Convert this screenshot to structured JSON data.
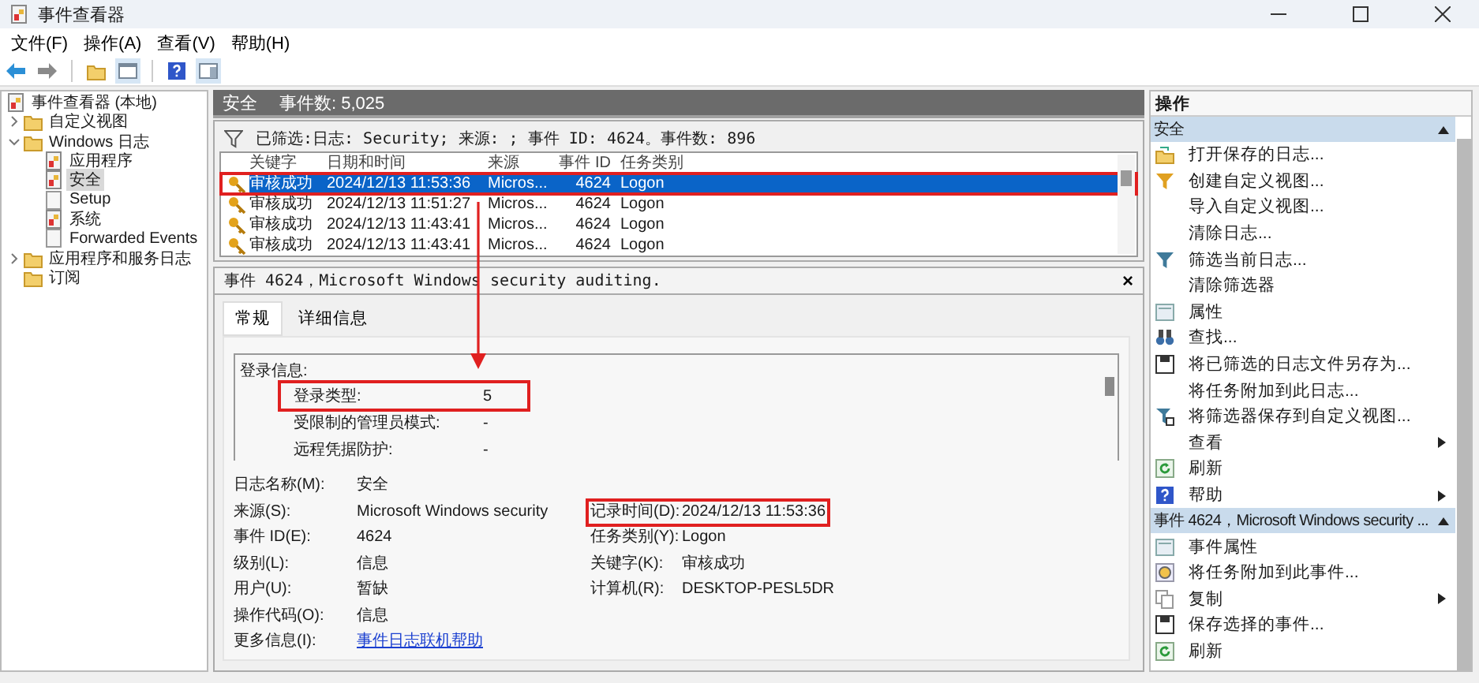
{
  "window": {
    "title": "事件查看器"
  },
  "menu": [
    "文件(F)",
    "操作(A)",
    "查看(V)",
    "帮助(H)"
  ],
  "tree": [
    {
      "label": "事件查看器 (本地)",
      "selected": false,
      "children": [
        {
          "label": "自定义视图",
          "expanded": false,
          "selected": false
        },
        {
          "label": "Windows 日志",
          "expanded": true,
          "selected": false,
          "children": [
            {
              "label": "应用程序",
              "selected": false
            },
            {
              "label": "安全",
              "selected": true
            },
            {
              "label": "Setup",
              "selected": false
            },
            {
              "label": "系统",
              "selected": false
            },
            {
              "label": "Forwarded Events",
              "selected": false
            }
          ]
        },
        {
          "label": "应用程序和服务日志",
          "expanded": false,
          "selected": false
        },
        {
          "label": "订阅",
          "selected": false
        }
      ]
    }
  ],
  "log_header": {
    "title": "安全",
    "count": "事件数: 5,025"
  },
  "filter": "已筛选:日志: Security; 来源: ; 事件 ID: 4624。事件数: 896",
  "events": {
    "columns": [
      "关键字",
      "日期和时间",
      "来源",
      "事件 ID",
      "任务类别"
    ],
    "rows": [
      {
        "cells": [
          "审核成功",
          "2024/12/13 11:53:36",
          "Micros...",
          "4624",
          "Logon"
        ],
        "selected": true,
        "highlighted": true
      },
      {
        "cells": [
          "审核成功",
          "2024/12/13 11:51:27",
          "Micros...",
          "4624",
          "Logon"
        ],
        "selected": false,
        "highlighted": false
      },
      {
        "cells": [
          "审核成功",
          "2024/12/13 11:43:41",
          "Micros...",
          "4624",
          "Logon"
        ],
        "selected": false,
        "highlighted": false
      },
      {
        "cells": [
          "审核成功",
          "2024/12/13 11:43:41",
          "Micros...",
          "4624",
          "Logon"
        ],
        "selected": false,
        "highlighted": false
      }
    ]
  },
  "detail": {
    "title": "事件 4624，Microsoft Windows security auditing.",
    "close": "×",
    "tabs": [
      {
        "label": "常规",
        "selected": true
      },
      {
        "label": "详细信息",
        "selected": false
      }
    ],
    "description": {
      "heading": "登录信息:",
      "lines": [
        {
          "label": "登录类型:",
          "value": "5",
          "highlighted": true
        },
        {
          "label": "受限制的管理员模式:",
          "value": "-",
          "highlighted": false
        },
        {
          "label": "远程凭据防护:",
          "value": "-",
          "highlighted": false
        }
      ]
    },
    "fields": [
      [
        {
          "label": "日志名称(M):",
          "value": "安全",
          "kind": "text"
        }
      ],
      [
        {
          "label": "来源(S):",
          "value": "Microsoft Windows security",
          "kind": "text"
        },
        {
          "label": "记录时间(D):",
          "value": "2024/12/13 11:53:36",
          "kind": "text",
          "highlighted": true
        }
      ],
      [
        {
          "label": "事件 ID(E):",
          "value": "4624",
          "kind": "text"
        },
        {
          "label": "任务类别(Y):",
          "value": "Logon",
          "kind": "text"
        }
      ],
      [
        {
          "label": "级别(L):",
          "value": "信息",
          "kind": "text"
        },
        {
          "label": "关键字(K):",
          "value": "审核成功",
          "kind": "text"
        }
      ],
      [
        {
          "label": "用户(U):",
          "value": "暂缺",
          "kind": "text"
        },
        {
          "label": "计算机(R):",
          "value": "DESKTOP-PESL5DR",
          "kind": "text"
        }
      ],
      [
        {
          "label": "操作代码(O):",
          "value": "信息",
          "kind": "text"
        }
      ],
      [
        {
          "label": "更多信息(I):",
          "value": "事件日志联机帮助",
          "kind": "link"
        }
      ]
    ]
  },
  "actions": {
    "title": "操作",
    "sections": [
      {
        "title": "安全",
        "expanded": true,
        "items": [
          {
            "label": "打开保存的日志...",
            "submenu": false
          },
          {
            "label": "创建自定义视图...",
            "submenu": false
          },
          {
            "label": "导入自定义视图...",
            "submenu": false
          },
          {
            "label": "清除日志...",
            "submenu": false
          },
          {
            "label": "筛选当前日志...",
            "submenu": false
          },
          {
            "label": "清除筛选器",
            "submenu": false
          },
          {
            "label": "属性",
            "submenu": false
          },
          {
            "label": "查找...",
            "submenu": false
          },
          {
            "label": "将已筛选的日志文件另存为...",
            "submenu": false
          },
          {
            "label": "将任务附加到此日志...",
            "submenu": false
          },
          {
            "label": "将筛选器保存到自定义视图...",
            "submenu": false
          },
          {
            "label": "查看",
            "submenu": true
          },
          {
            "label": "刷新",
            "submenu": false
          },
          {
            "label": "帮助",
            "submenu": true
          }
        ]
      },
      {
        "title": "事件 4624，Microsoft Windows security ...",
        "expanded": true,
        "items": [
          {
            "label": "事件属性",
            "submenu": false
          },
          {
            "label": "将任务附加到此事件...",
            "submenu": false
          },
          {
            "label": "复制",
            "submenu": true
          },
          {
            "label": "保存选择的事件...",
            "submenu": false
          },
          {
            "label": "刷新",
            "submenu": false
          }
        ]
      }
    ]
  }
}
